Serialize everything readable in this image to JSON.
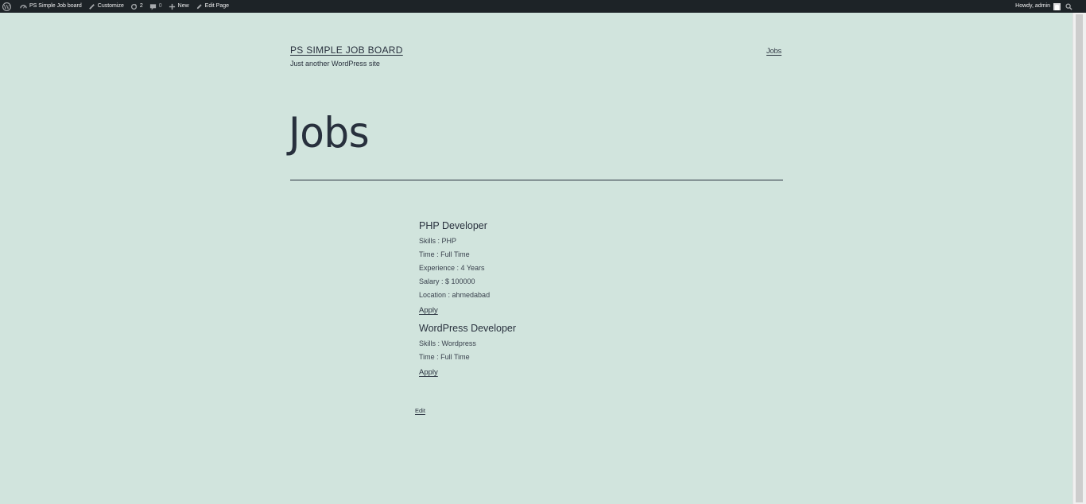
{
  "admin_bar": {
    "site_name": "PS Simple Job board",
    "customize": "Customize",
    "updates_count": "2",
    "comments_count": "0",
    "new": "New",
    "edit_page": "Edit Page",
    "howdy": "Howdy, admin"
  },
  "header": {
    "site_title": "PS SIMPLE JOB BOARD",
    "tagline": "Just another WordPress site",
    "nav_jobs": "Jobs"
  },
  "page": {
    "title": "Jobs",
    "edit_label": "Edit"
  },
  "jobs": [
    {
      "title": "PHP Developer",
      "fields": [
        "Skills : PHP",
        "Time : Full Time",
        "Experience : 4 Years",
        "Salary : $ 100000",
        "Location : ahmedabad"
      ],
      "apply_label": "Apply"
    },
    {
      "title": "WordPress Developer",
      "fields": [
        "Skills : Wordpress",
        "Time : Full Time"
      ],
      "apply_label": "Apply"
    }
  ],
  "icons": [
    "wordpress-logo-icon",
    "dashboard-icon",
    "brush-icon",
    "updates-icon",
    "comment-icon",
    "plus-icon",
    "pencil-icon",
    "avatar",
    "search-icon"
  ]
}
